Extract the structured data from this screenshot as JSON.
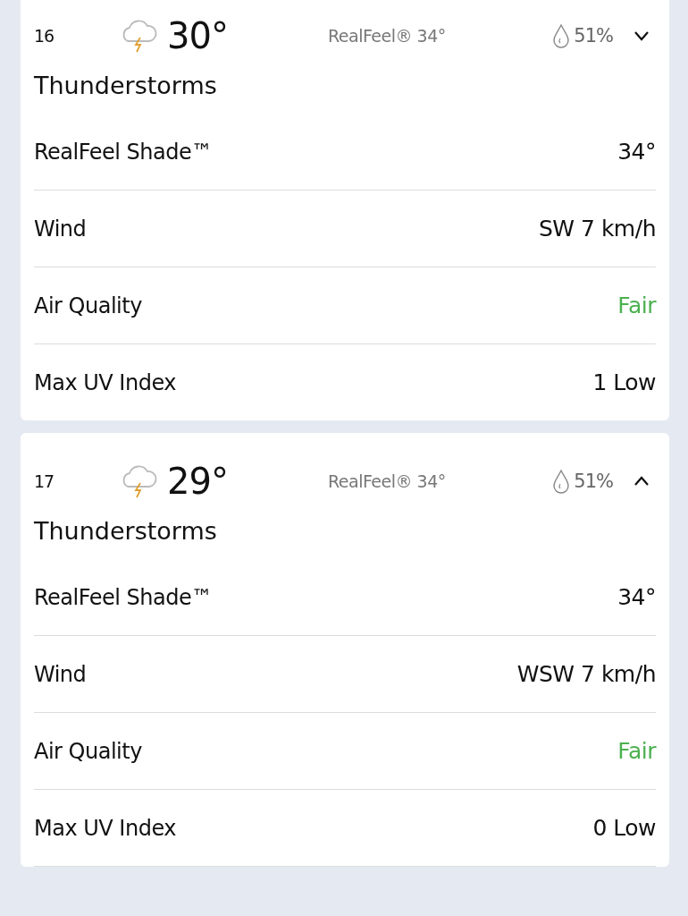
{
  "hours": [
    {
      "hour": "16",
      "temperature": "30°",
      "realfeel": "RealFeel® 34°",
      "precipitation": "51%",
      "expanded": false,
      "condition": "Thunderstorms",
      "details": [
        {
          "label": "RealFeel Shade™",
          "value": "34°"
        },
        {
          "label": "Wind",
          "value": "SW 7 km/h"
        },
        {
          "label": "Air Quality",
          "value": "Fair",
          "color": "#4cb050"
        },
        {
          "label": "Max UV Index",
          "value": "1 Low"
        }
      ]
    },
    {
      "hour": "17",
      "temperature": "29°",
      "realfeel": "RealFeel® 34°",
      "precipitation": "51%",
      "expanded": true,
      "condition": "Thunderstorms",
      "details": [
        {
          "label": "RealFeel Shade™",
          "value": "34°"
        },
        {
          "label": "Wind",
          "value": "WSW 7 km/h"
        },
        {
          "label": "Air Quality",
          "value": "Fair",
          "color": "#4cb050"
        },
        {
          "label": "Max UV Index",
          "value": "0 Low"
        }
      ]
    }
  ]
}
